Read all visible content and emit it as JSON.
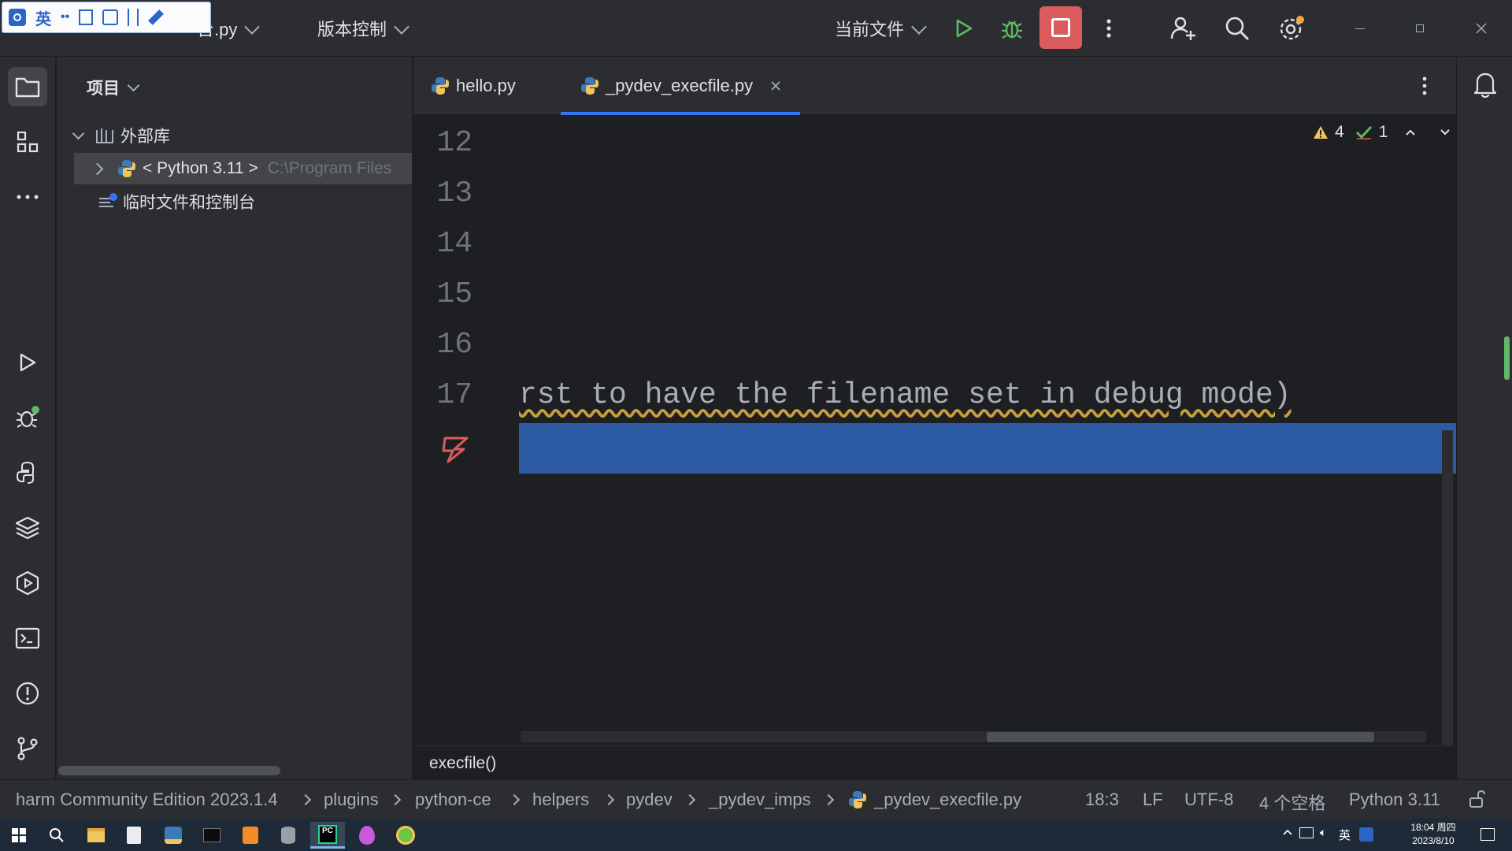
{
  "titlebar": {
    "project_name": "临时控制台.py",
    "project_name_visible": "台.py",
    "vcs_label": "版本控制",
    "run_config": "当前文件"
  },
  "ime_toolbar": {
    "lang": "英"
  },
  "project_panel": {
    "title": "项目",
    "root_label": "外部库",
    "python_label": "< Python 3.11 >",
    "python_path": "C:\\Program Files",
    "scratches_label": "临时文件和控制台"
  },
  "tabs": [
    {
      "label": "hello.py",
      "active": false
    },
    {
      "label": "_pydev_execfile.py",
      "active": true,
      "closable": true
    }
  ],
  "editor": {
    "line_numbers": [
      "12",
      "13",
      "14",
      "15",
      "16",
      "17"
    ],
    "line17_text": "rst to have the filename set in debug mode)",
    "inspections": {
      "warnings": "4",
      "ok": "1"
    },
    "footer_breadcrumb": "execfile()"
  },
  "statusbar": {
    "path": [
      "harm Community Edition 2023.1.4",
      "plugins",
      "python-ce",
      "helpers",
      "pydev",
      "_pydev_imps",
      "_pydev_execfile.py"
    ],
    "position": "18:3",
    "line_sep": "LF",
    "encoding": "UTF-8",
    "indent": "4 个空格",
    "interpreter": "Python 3.11"
  },
  "taskbar": {
    "time": "18:04 周四",
    "date": "2023/8/10",
    "ime": "英"
  },
  "colors": {
    "accent": "#3574f0",
    "stop_red": "#db5c5c",
    "run_green": "#5fb865",
    "selection": "#2e5ca4",
    "warning": "#f2c55c"
  }
}
